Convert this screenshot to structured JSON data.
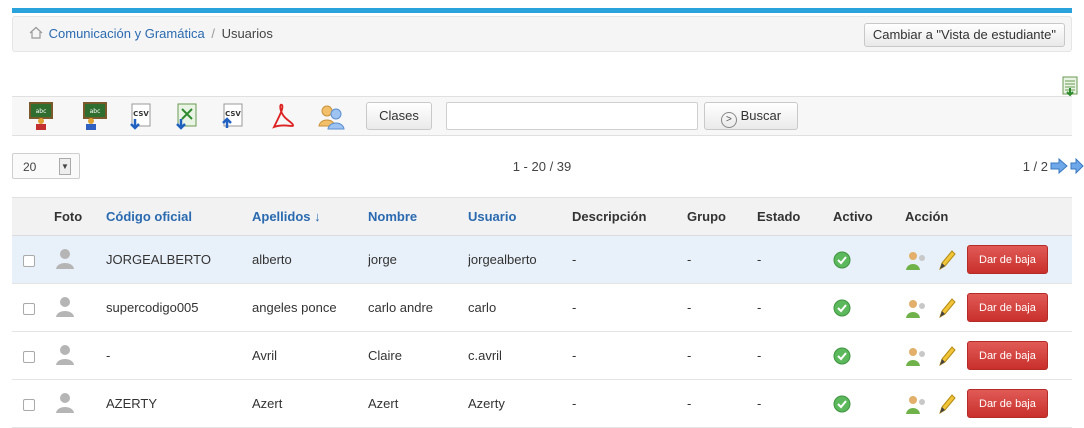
{
  "breadcrumb": {
    "course": "Comunicación y Gramática",
    "separator": "/",
    "current": "Usuarios"
  },
  "switch_view_label": "Cambiar a \"Vista de estudiante\"",
  "toolbar": {
    "icons": [
      "teacher-board-icon",
      "teacher-board-icon",
      "csv-import-icon",
      "excel-import-icon",
      "csv-export-icon",
      "pdf-icon",
      "users-group-icon"
    ],
    "clases_label": "Clases",
    "search_value": "",
    "search_button_label": "Buscar"
  },
  "pagination": {
    "per_page": "20",
    "range": "1 - 20 / 39",
    "pages": "1 / 2"
  },
  "table": {
    "headers": {
      "foto": "Foto",
      "codigo": "Código oficial",
      "apellidos": "Apellidos ↓",
      "nombre": "Nombre",
      "usuario": "Usuario",
      "descripcion": "Descripción",
      "grupo": "Grupo",
      "estado": "Estado",
      "activo": "Activo",
      "accion": "Acción"
    },
    "rows": [
      {
        "codigo": "JORGEALBERTO",
        "apellidos": "alberto",
        "nombre": "jorge",
        "usuario": "jorgealberto",
        "descripcion": "-",
        "grupo": "-",
        "estado": "-",
        "baja": "Dar de baja"
      },
      {
        "codigo": "supercodigo005",
        "apellidos": "angeles ponce",
        "nombre": "carlo andre",
        "usuario": "carlo",
        "descripcion": "-",
        "grupo": "-",
        "estado": "-",
        "baja": "Dar de baja"
      },
      {
        "codigo": "-",
        "apellidos": "Avril",
        "nombre": "Claire",
        "usuario": "c.avril",
        "descripcion": "-",
        "grupo": "-",
        "estado": "-",
        "baja": "Dar de baja"
      },
      {
        "codigo": "AZERTY",
        "apellidos": "Azert",
        "nombre": "Azert",
        "usuario": "Azerty",
        "descripcion": "-",
        "grupo": "-",
        "estado": "-",
        "baja": "Dar de baja"
      }
    ]
  },
  "colors": {
    "accent": "#2aa3dc",
    "link": "#2a6ab0",
    "danger": "#d9534f",
    "active": "#5cb85c"
  }
}
